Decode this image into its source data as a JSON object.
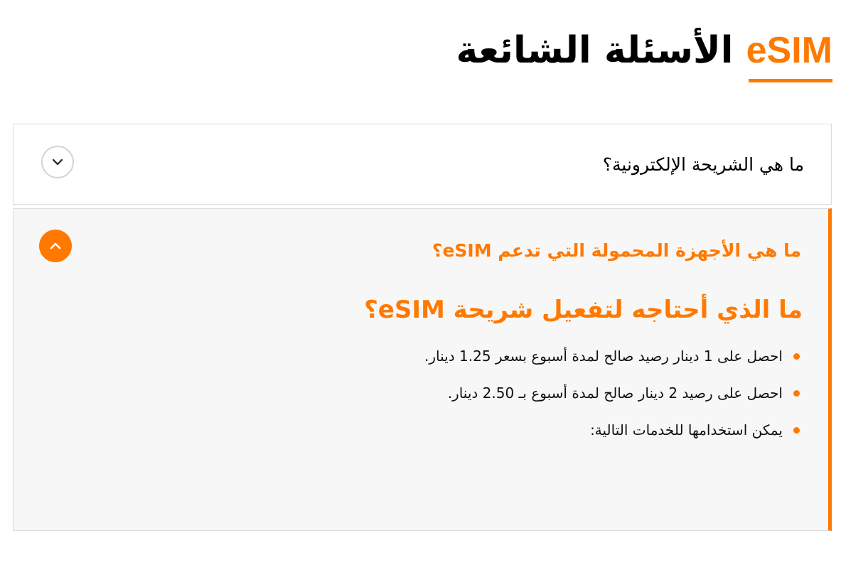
{
  "header": {
    "title_text": "الأسئلة الشائعة",
    "title_brand": "eSIM"
  },
  "faq": [
    {
      "question": "ما هي الشريحة الإلكترونية؟",
      "state": "collapsed",
      "icon": "chevron-down-icon"
    },
    {
      "question": "ما هي الأجهزة المحمولة التي تدعم eSIM؟",
      "state": "expanded",
      "icon": "chevron-up-icon",
      "answer": {
        "heading": "ما الذي أحتاجه لتفعيل شريحة eSIM؟",
        "bullets": [
          "احصل على 1 دينار رصيد صالح لمدة أسبوع بسعر 1.25 دينار.",
          "احصل على رصيد 2 دينار صالح لمدة أسبوع بـ 2.50 دينار.",
          "يمكن استخدامها للخدمات التالية:"
        ]
      }
    }
  ],
  "colors": {
    "accent": "#ff7900",
    "expanded_bg": "#f7f7f7",
    "border": "#dcdcdc"
  }
}
